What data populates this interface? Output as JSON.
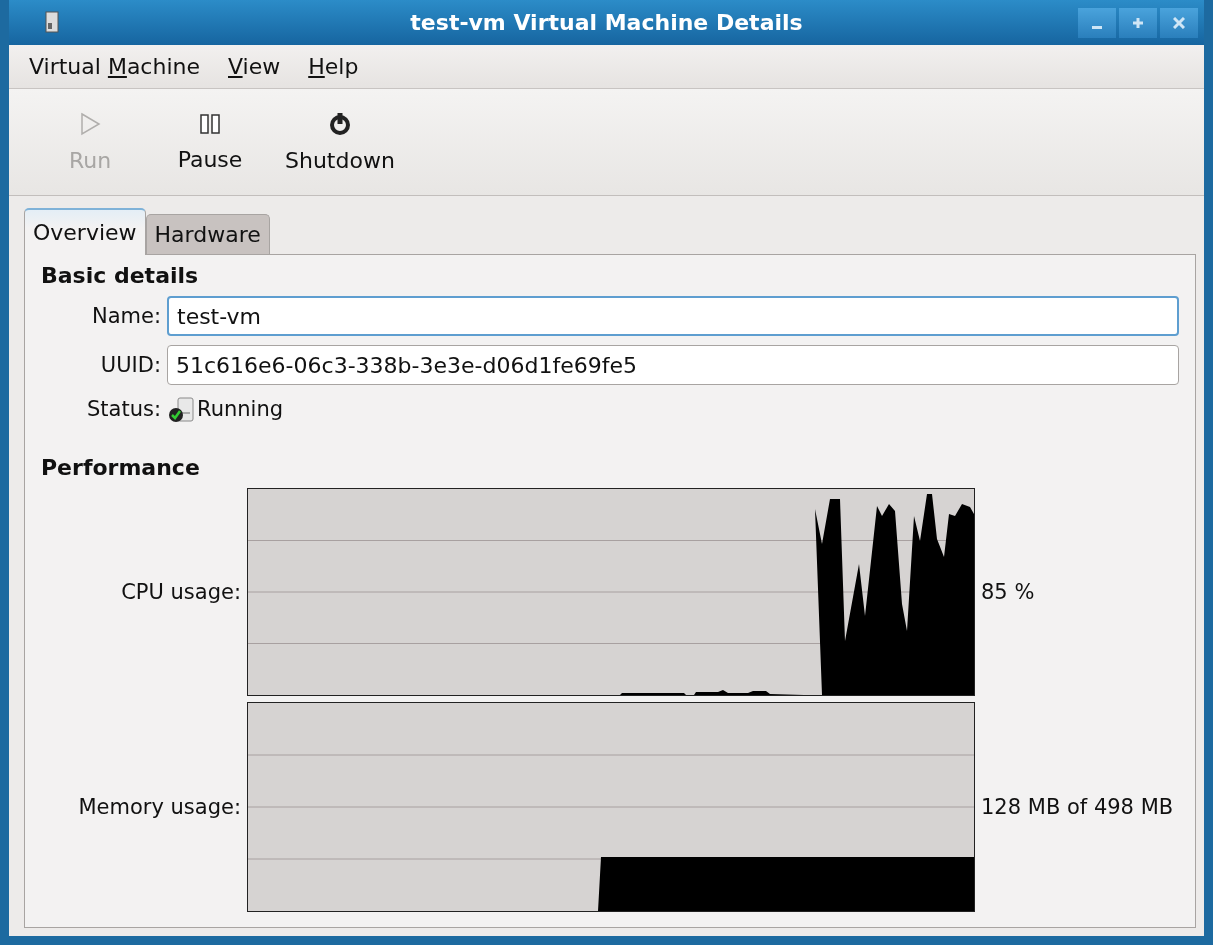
{
  "window": {
    "title": "test-vm Virtual Machine Details"
  },
  "menu": [
    {
      "before": "Virtual ",
      "key": "M",
      "after": "achine"
    },
    {
      "key": "V",
      "after": "iew"
    },
    {
      "key": "H",
      "after": "elp"
    }
  ],
  "toolbar": [
    {
      "kind": "run",
      "label": "Run",
      "disabled": true
    },
    {
      "kind": "pause",
      "label": "Pause",
      "disabled": false
    },
    {
      "kind": "shutdown",
      "label": "Shutdown",
      "disabled": false
    }
  ],
  "tabs": [
    {
      "label": "Overview",
      "selected": true
    },
    {
      "label": "Hardware",
      "selected": false
    }
  ],
  "basic_details": {
    "heading": "Basic details",
    "name_label": "Name:",
    "name_value": "test-vm",
    "uuid_label": "UUID:",
    "uuid_value": "51c616e6-06c3-338b-3e3e-d06d1fe69fe5",
    "status_label": "Status:",
    "status_value": "Running"
  },
  "performance": {
    "heading": "Performance",
    "graphs": [
      {
        "kind": "cpu",
        "label": "CPU usage:",
        "reading": "85 %"
      },
      {
        "kind": "memory",
        "label": "Memory usage:",
        "reading": "128 MB of 498 MB"
      }
    ]
  }
}
